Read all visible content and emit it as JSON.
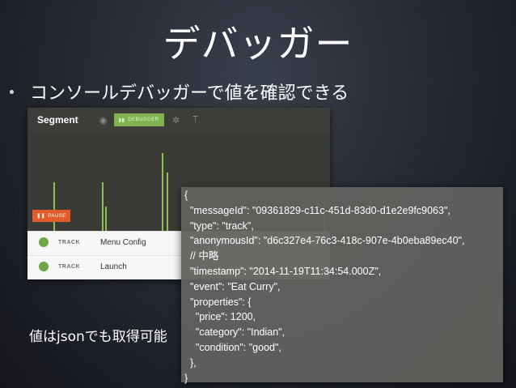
{
  "slide": {
    "title": "デバッガー",
    "bullet": "コンソールデバッガーで値を確認できる",
    "caption": "値はjsonでも取得可能"
  },
  "debugger": {
    "brand": "Segment",
    "tab_label": "DEBUGGER",
    "pause_label": "PAUSE",
    "events": [
      {
        "type": "TRACK",
        "name": "Menu Config"
      },
      {
        "type": "TRACK",
        "name": "Launch"
      }
    ],
    "icons": [
      "eye-icon",
      "gear-icon",
      "filter-icon",
      "pause-icon",
      "bars-icon"
    ],
    "colors": {
      "accent": "#8cc152",
      "pause": "#e25c2a",
      "header": "#3d3e3a"
    }
  },
  "json_panel": {
    "lines": [
      "{",
      "  \"messageId\": \"09361829-c11c-451d-83d0-d1e2e9fc9063\",",
      "  \"type\": \"track\",",
      "  \"anonymousId\": \"d6c327e4-76c3-418c-907e-4b0eba89ec40\",",
      "  // 中略",
      "  \"timestamp\": \"2014-11-19T11:34:54.000Z\",",
      "  \"event\": \"Eat Curry\",",
      "  \"properties\": {",
      "    \"price\": 1200,",
      "    \"category\": \"Indian\",",
      "    \"condition\": \"good\",",
      "  },",
      "}"
    ]
  }
}
